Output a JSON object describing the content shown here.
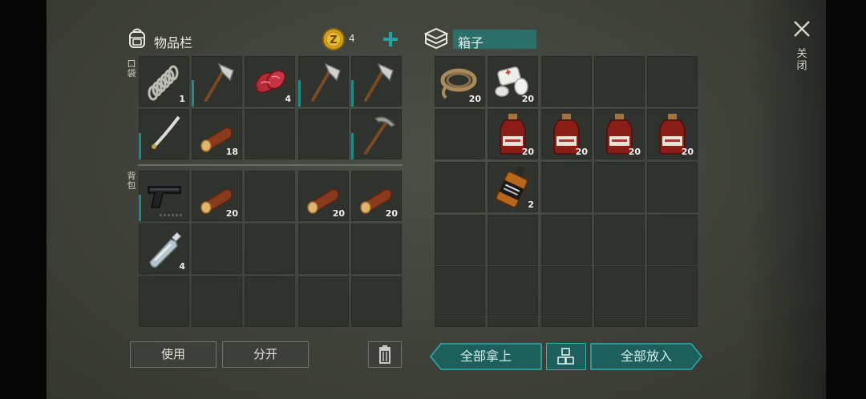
{
  "inventory": {
    "title": "物品栏",
    "coins": "4",
    "pockets_label": "口袋",
    "backpack_label": "背包",
    "pockets": [
      {
        "icon": "spring-coil-icon",
        "count": "1"
      },
      {
        "icon": "hatchet-icon",
        "count": ""
      },
      {
        "icon": "raw-meat-icon",
        "count": "4"
      },
      {
        "icon": "hatchet-icon",
        "count": ""
      },
      {
        "icon": "hatchet-icon",
        "count": ""
      },
      {
        "icon": "katana-icon",
        "count": ""
      },
      {
        "icon": "log-icon",
        "count": "18"
      },
      {
        "icon": "empty",
        "count": ""
      },
      {
        "icon": "empty",
        "count": ""
      },
      {
        "icon": "pickaxe-icon",
        "count": ""
      }
    ],
    "backpack": [
      {
        "icon": "pistol-icon",
        "count": ""
      },
      {
        "icon": "log-icon",
        "count": "20"
      },
      {
        "icon": "empty",
        "count": ""
      },
      {
        "icon": "log-icon",
        "count": "20"
      },
      {
        "icon": "log-icon",
        "count": "20"
      },
      {
        "icon": "water-bottle-icon",
        "count": "4"
      }
    ]
  },
  "box": {
    "title": "箱子",
    "items": [
      {
        "icon": "rope-icon",
        "count": "20"
      },
      {
        "icon": "bandage-icon",
        "count": "20"
      },
      {
        "icon": "empty",
        "count": ""
      },
      {
        "icon": "empty",
        "count": ""
      },
      {
        "icon": "empty",
        "count": ""
      },
      {
        "icon": "empty",
        "count": ""
      },
      {
        "icon": "medicine-bottle-icon",
        "count": "20"
      },
      {
        "icon": "medicine-bottle-icon",
        "count": "20"
      },
      {
        "icon": "medicine-bottle-icon",
        "count": "20"
      },
      {
        "icon": "medicine-bottle-icon",
        "count": "20"
      },
      {
        "icon": "empty",
        "count": ""
      },
      {
        "icon": "whiskey-bottle-icon",
        "count": "2"
      }
    ]
  },
  "buttons": {
    "use": "使用",
    "split": "分开",
    "take_all": "全部拿上",
    "put_all": "全部放入"
  },
  "close_label": "关闭",
  "colors": {
    "accent_teal": "#1e8b88",
    "slot_bg": "#2f322d"
  }
}
